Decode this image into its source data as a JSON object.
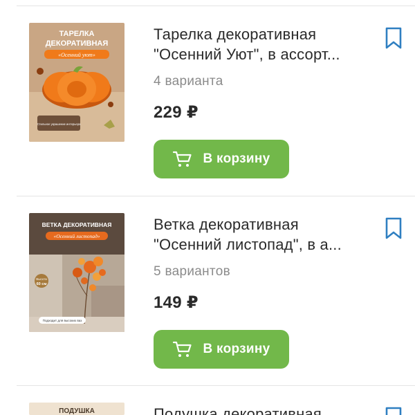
{
  "products": [
    {
      "title_line1": "Тарелка декоративная",
      "title_line2": "\"Осенний Уют\", в ассорт...",
      "variants": "4 варианта",
      "price": "229 ₽",
      "cart_label": "В корзину",
      "image": {
        "heading1": "ТАРЕЛКА",
        "heading2": "ДЕКОРАТИВНАЯ",
        "tagline": "«Осенний уют»",
        "caption": "Стильное украшение интерьера",
        "bg_color": "#c9a684",
        "object_color": "#f07a1a"
      }
    },
    {
      "title_line1": "Ветка декоративная",
      "title_line2": "\"Осенний листопад\", в а...",
      "variants": "5 вариантов",
      "price": "149 ₽",
      "cart_label": "В корзину",
      "image": {
        "heading1": "ВЕТКА ДЕКОРАТИВНАЯ",
        "tagline": "«Осенний листопад»",
        "badge_label": "Высота",
        "badge_value": "60 см",
        "caption": "Подходит для высоких ваз",
        "bg_color": "#5b4a3e",
        "object_color": "#e66a1e"
      }
    },
    {
      "title_line1": "Подушка декоративная",
      "image": {
        "heading1": "ПОДУШКА",
        "bg_color": "#efe2d0"
      }
    }
  ],
  "colors": {
    "accent_green": "#72b84a",
    "bookmark_blue": "#2f7fc1",
    "muted_text": "#8b8b8b"
  },
  "icons": {
    "cart": "cart-icon",
    "bookmark": "bookmark-icon"
  }
}
